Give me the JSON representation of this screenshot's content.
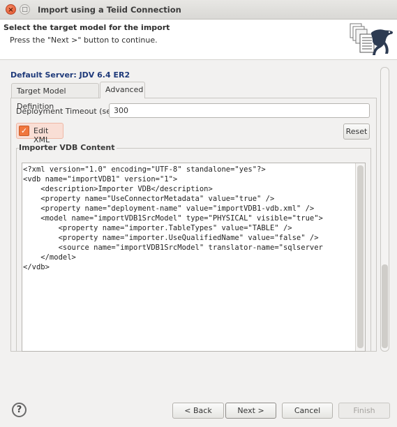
{
  "window": {
    "title": "Import using a Teiid Connection",
    "close_glyph": "×",
    "maximize_glyph": "□"
  },
  "header": {
    "title": "Select the target model for the import",
    "subtitle": "Press the \"Next >\" button to continue.",
    "icon": "teiid-import-wizard-icon"
  },
  "server": {
    "label": "Default Server: JDV 6.4 ER2"
  },
  "tabs": [
    {
      "label": "Target Model Definition",
      "active": false
    },
    {
      "label": "Advanced",
      "active": true
    }
  ],
  "advanced": {
    "timeout_label": "Deployment Timeout (sec):",
    "timeout_value": "300",
    "edit_xml_label": "Edit XML",
    "edit_xml_checked": true,
    "reset_label": "Reset",
    "group_title": "Importer VDB Content",
    "xml_lines": [
      "<?xml version=\"1.0\" encoding=\"UTF-8\" standalone=\"yes\"?>",
      "<vdb name=\"importVDB1\" version=\"1\">",
      "    <description>Importer VDB</description>",
      "    <property name=\"UseConnectorMetadata\" value=\"true\" />",
      "    <property name=\"deployment-name\" value=\"importVDB1-vdb.xml\" />",
      "    <model name=\"importVDB1SrcModel\" type=\"PHYSICAL\" visible=\"true\">",
      "        <property name=\"importer.TableTypes\" value=\"TABLE\" />",
      "        <property name=\"importer.UseQualifiedName\" value=\"false\" />",
      "        <source name=\"importVDB1SrcModel\" translator-name=\"sqlserver",
      "    </model>",
      "</vdb>"
    ]
  },
  "footer": {
    "help_glyph": "?",
    "back_label": "< Back",
    "next_label": "Next >",
    "cancel_label": "Cancel",
    "finish_label": "Finish",
    "finish_enabled": false
  },
  "colors": {
    "server_label": "#1f3a7a",
    "checkbox_accent": "#f0763d",
    "close_button": "#e2532b"
  }
}
